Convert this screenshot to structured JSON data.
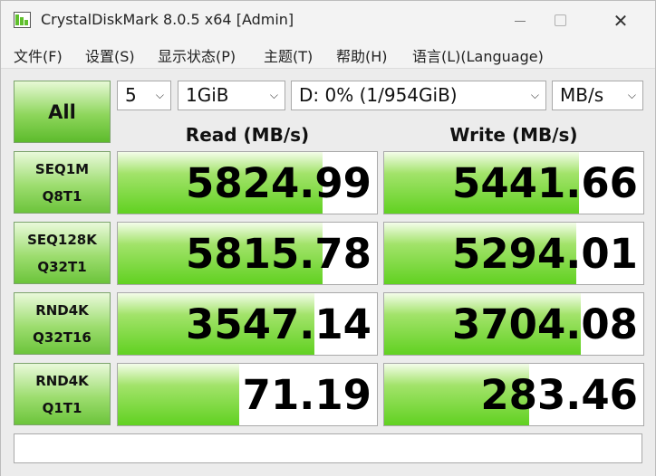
{
  "window": {
    "title": "CrystalDiskMark 8.0.5 x64 [Admin]",
    "close_glyph": "✕"
  },
  "menu": {
    "file": "文件(F)",
    "settings": "设置(S)",
    "display": "显示状态(P)",
    "theme": "主题(T)",
    "help": "帮助(H)",
    "language": "语言(L)(Language)"
  },
  "controls": {
    "all_label": "All",
    "count": "5",
    "size": "1GiB",
    "drive": "D: 0% (1/954GiB)",
    "unit": "MB/s"
  },
  "headers": {
    "read": "Read (MB/s)",
    "write": "Write (MB/s)"
  },
  "tests": [
    {
      "line1": "SEQ1M",
      "line2": "Q8T1",
      "read": "5824.99",
      "write": "5441.66",
      "read_fill": 0.79,
      "write_fill": 0.75
    },
    {
      "line1": "SEQ128K",
      "line2": "Q32T1",
      "read": "5815.78",
      "write": "5294.01",
      "read_fill": 0.79,
      "write_fill": 0.74
    },
    {
      "line1": "RND4K",
      "line2": "Q32T16",
      "read": "3547.14",
      "write": "3704.08",
      "read_fill": 0.76,
      "write_fill": 0.76
    },
    {
      "line1": "RND4K",
      "line2": "Q1T1",
      "read": "71.19",
      "write": "283.46",
      "read_fill": 0.47,
      "write_fill": 0.56
    }
  ],
  "comment": "",
  "colors": {
    "bar_green": "#61d121",
    "button_green": "#8ed65c"
  },
  "icons": {
    "app": "crystaldiskmark-icon",
    "dropdown": "chevron-down-icon"
  }
}
